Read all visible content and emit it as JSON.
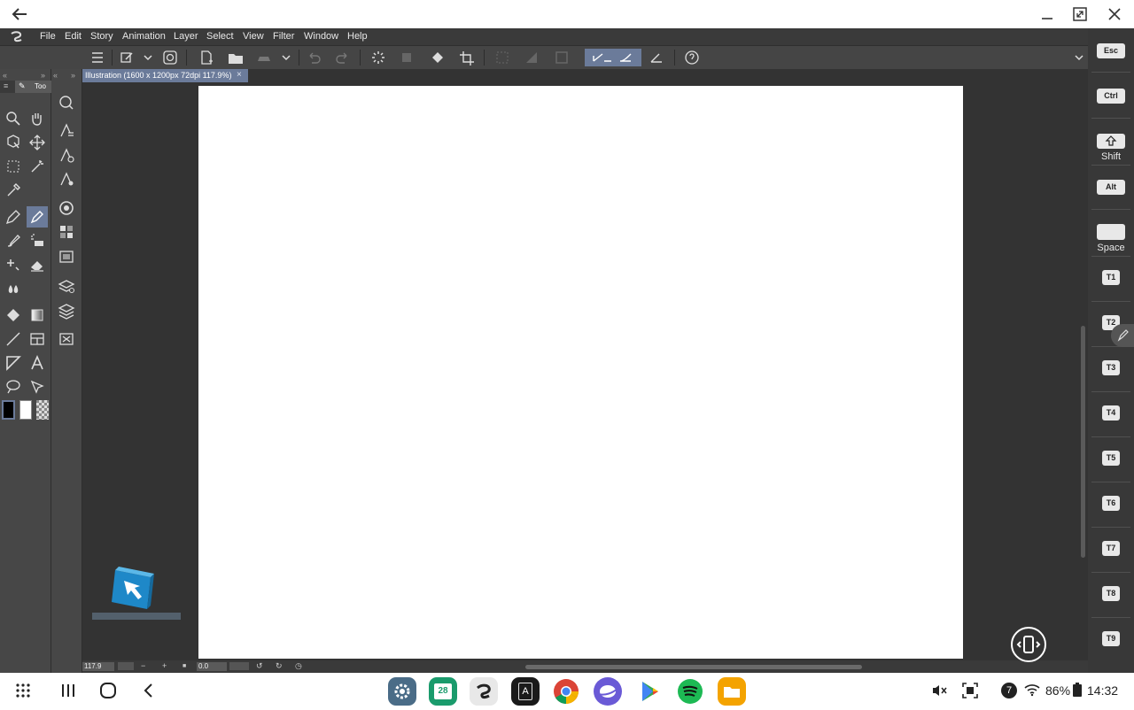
{
  "window": {
    "back_icon": "arrow-left-icon",
    "minimize_icon": "minimize-icon",
    "restore_icon": "restore-icon",
    "close_icon": "close-icon"
  },
  "menu": {
    "logo_icon": "clip-studio-logo-icon",
    "items": [
      "File",
      "Edit",
      "Story",
      "Animation",
      "Layer",
      "Select",
      "View",
      "Filter",
      "Window",
      "Help"
    ]
  },
  "toolbar_tab": {
    "label": "Too"
  },
  "document_tab": {
    "title": "Illustration (1600 x 1200px 72dpi 117.9%)",
    "close_glyph": "×"
  },
  "status": {
    "zoom": "117.9",
    "rotation": "0.0"
  },
  "keys": {
    "esc": "Esc",
    "ctrl": "Ctrl",
    "shift": "Shift",
    "alt": "Alt",
    "space": "Space",
    "t": [
      "T1",
      "T2",
      "T3",
      "T4",
      "T5",
      "T6",
      "T7",
      "T8",
      "T9"
    ]
  },
  "system": {
    "notification_count": "7",
    "battery": "86%",
    "time": "14:32"
  },
  "dock": [
    "settings-app-icon",
    "calendar-app-icon",
    "clip-studio-app-icon",
    "dex-app-icon",
    "chrome-app-icon",
    "internet-app-icon",
    "play-store-app-icon",
    "spotify-app-icon",
    "files-app-icon"
  ],
  "calendar_day": "28",
  "dex_letter": "A",
  "colors": {
    "accent": "#6b7b9a",
    "app_bg": "#3c3c3c",
    "canvas_bg": "#333333",
    "paper": "#ffffff"
  }
}
